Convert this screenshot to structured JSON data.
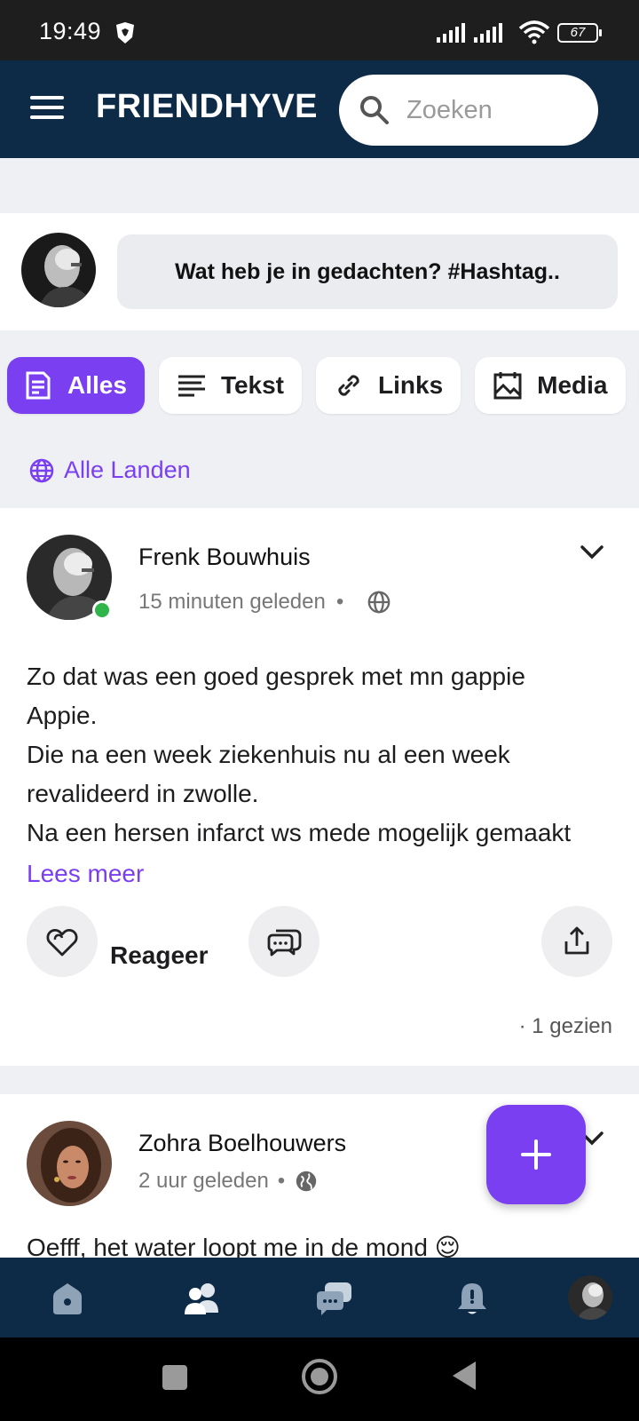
{
  "status_bar": {
    "time": "19:49",
    "battery": "67"
  },
  "header": {
    "brand": "FRIENDHYVE",
    "search_placeholder": "Zoeken"
  },
  "composer": {
    "prompt": "Wat heb je in gedachten? #Hashtag.."
  },
  "filters": [
    {
      "label": "Alles",
      "icon": "document-icon",
      "active": true
    },
    {
      "label": "Tekst",
      "icon": "text-lines-icon",
      "active": false
    },
    {
      "label": "Links",
      "icon": "link-icon",
      "active": false
    },
    {
      "label": "Media",
      "icon": "media-icon",
      "active": false
    }
  ],
  "countries_filter": {
    "label": "Alle Landen",
    "icon": "globe-icon"
  },
  "posts": [
    {
      "author": "Frenk Bouwhuis",
      "time": "15 minuten geleden",
      "separator": "•",
      "online": true,
      "body_lines": [
        "Zo dat was een goed gesprek met mn gappie",
        "Appie.",
        "Die na een week ziekenhuis nu al een week",
        "revalideerd in zwolle.",
        "Na een hersen infarct ws mede mogelijk gemaakt"
      ],
      "read_more": "Lees meer",
      "react_label": "Reageer",
      "views": "· 1 gezien"
    },
    {
      "author": "Zohra Boelhouwers",
      "time": "2 uur geleden",
      "separator": "•",
      "body_preview": "Oefff, het water loopt me in de mond 😌"
    }
  ],
  "bottom_nav": [
    "home-icon",
    "friends-icon",
    "chat-icon",
    "bell-icon",
    "profile-avatar"
  ],
  "colors": {
    "header": "#0d2a47",
    "accent": "#7b3ff2",
    "online": "#2fb54a"
  }
}
